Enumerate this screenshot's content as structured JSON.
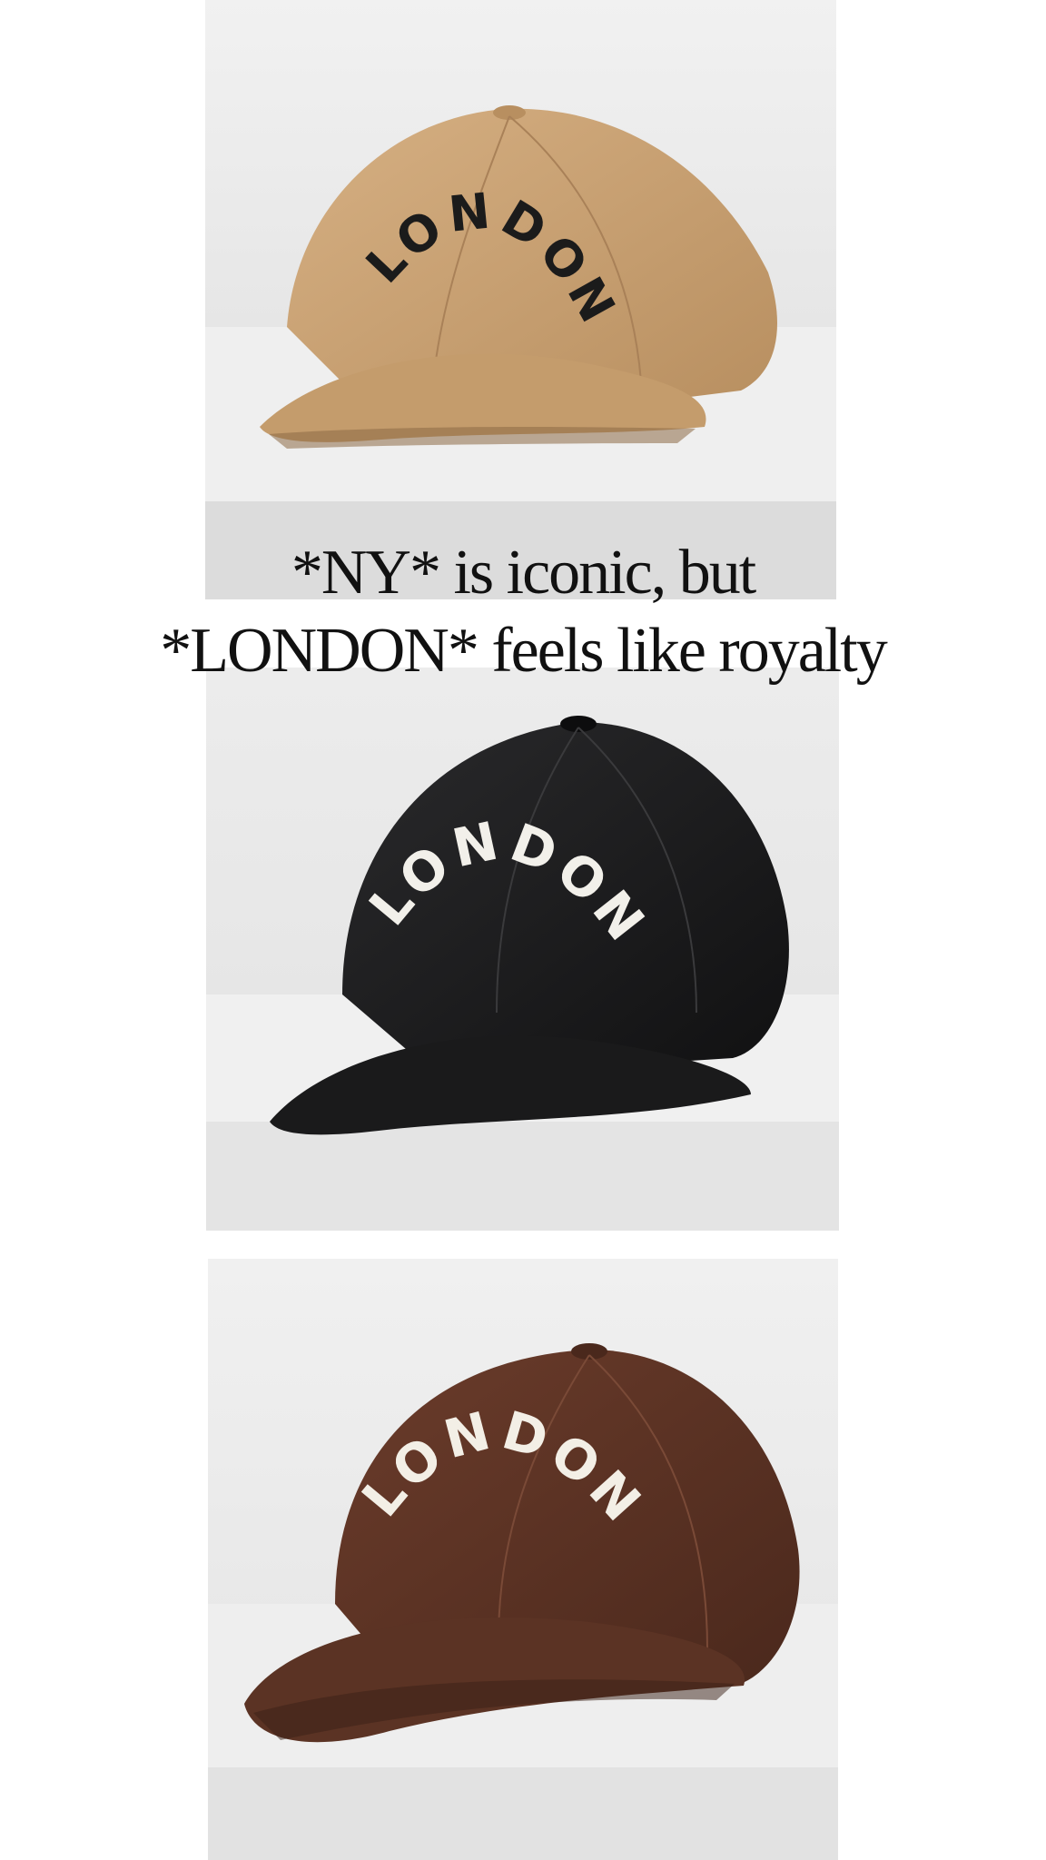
{
  "caption": {
    "line1": "*NY* is iconic, but",
    "line2": "*LONDON* feels like royalty"
  },
  "products": [
    {
      "name": "tan-cap",
      "embroidery": "LONDON",
      "cap_color": "#c9a271",
      "text_color": "#1b1b1b"
    },
    {
      "name": "black-cap",
      "embroidery": "LONDON",
      "cap_color": "#1c1c1e",
      "text_color": "#f2f0ea"
    },
    {
      "name": "brown-cap",
      "embroidery": "LONDON",
      "cap_color": "#5a3224",
      "text_color": "#f3efe6"
    }
  ]
}
